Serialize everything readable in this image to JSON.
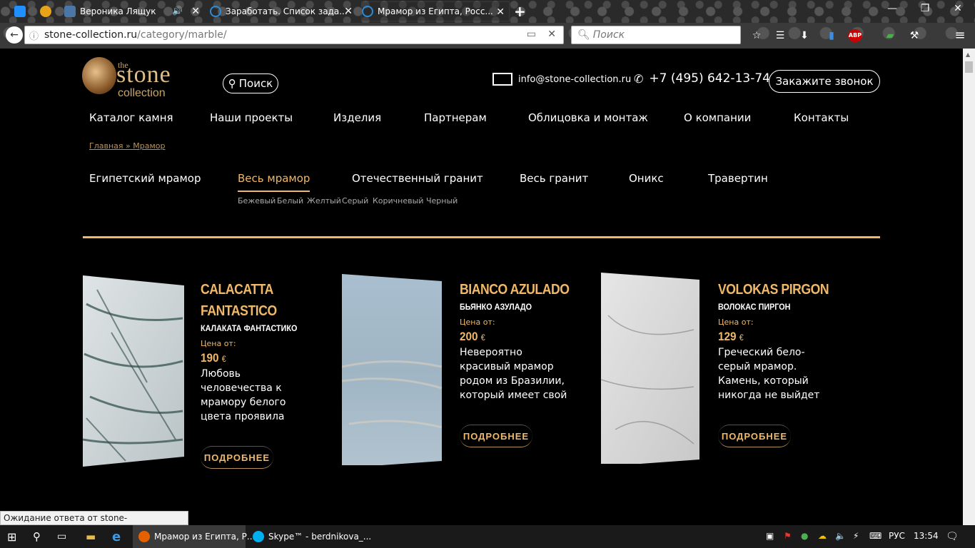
{
  "browser": {
    "tabs": [
      {
        "label": "Вероника Лящук"
      },
      {
        "label": "Заработать. Список зада..."
      },
      {
        "label": "Мрамор из Египта, Росс..."
      }
    ],
    "new_tab": "+",
    "url_host": "stone-collection.ru",
    "url_path": "/category/marble/",
    "search_placeholder": "Поиск",
    "status_text": "Ожидание ответа от stone-collection.ru..."
  },
  "site": {
    "logo": {
      "the": "the",
      "stone": "stone",
      "collection": "collection"
    },
    "search_label": "Поиск",
    "email": "info@stone-collection.ru",
    "phone": "+7 (495) 642-13-74",
    "callback_label": "Закажите звонок",
    "nav": [
      "Каталог камня",
      "Наши проекты",
      "Изделия",
      "Партнерам",
      "Облицовка и монтаж",
      "О компании",
      "Контакты"
    ],
    "breadcrumb": {
      "home": "Главная",
      "sep": "»",
      "current": "Мрамор"
    },
    "categories": [
      "Египетский мрамор",
      "Весь мрамор",
      "Отечественный гранит",
      "Весь гранит",
      "Оникс",
      "Травертин"
    ],
    "subcategories": [
      "Бежевый",
      "Белый",
      "Желтый",
      "Серый",
      "Коричневый",
      "Черный"
    ],
    "price_label": "Цена от:",
    "currency": "€",
    "more_label": "ПОДРОБНЕЕ",
    "products": [
      {
        "title_line1": "CALACATTA",
        "title_line2": "FANTASTICO",
        "subtitle": "КАЛАКАТА ФАНТАСТИКО",
        "price": "190",
        "description": "Любовь человечества к мрамору белого цвета проявила себя еще в глубокой древности. И"
      },
      {
        "title_line1": "BIANCO AZULADO",
        "title_line2": "",
        "subtitle": "БЬЯНКО АЗУЛАДО",
        "price": "200",
        "description": "Невероятно красивый мрамор родом из Бразилии, который имеет свой характер и свой стиль. К"
      },
      {
        "title_line1": "VOLOKAS PIRGON",
        "title_line2": "",
        "subtitle": "ВОЛОКАС ПИРГОН",
        "price": "129",
        "description": "Греческий бело-серый мрамор. Камень, который никогда не выйдет из моды и будет всегда в тренде"
      }
    ]
  },
  "taskbar": {
    "apps": [
      {
        "label": "Мрамор из Египта, Р..."
      },
      {
        "label": "Skype™ - berdnikova_..."
      }
    ],
    "lang": "РУС",
    "time": "13:54"
  },
  "colors": {
    "accent": "#f0b868",
    "gold_line": "#f1b86a",
    "breadcrumb": "#b8925a"
  }
}
